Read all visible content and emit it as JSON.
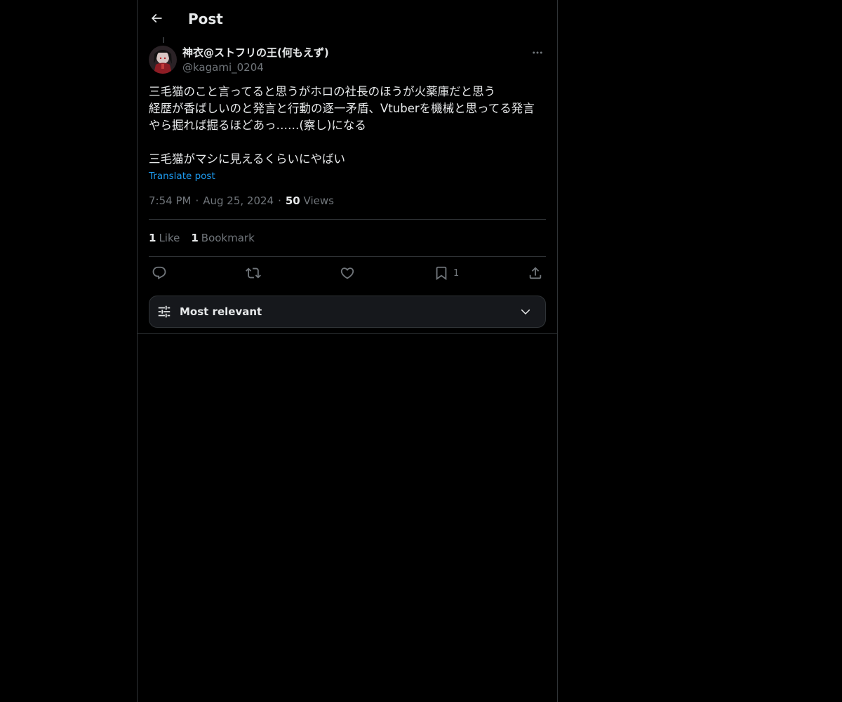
{
  "header": {
    "title": "Post",
    "back_icon": "arrow-left-icon"
  },
  "post": {
    "author": {
      "display_name": "神衣@ストフリの王(何もえず)",
      "handle": "@kagami_0204",
      "avatar_icon": "avatar-image"
    },
    "text": "三毛猫のこと言ってると思うがホロの社長のほうが火薬庫だと思う\n経歴が香ばしいのと発言と行動の逐一矛盾、Vtuberを機械と思ってる発言やら掘れば掘るほどあっ……(察し)になる\n\n三毛猫がマシに見えるくらいにやばい",
    "translate_label": "Translate post",
    "time": "7:54 PM",
    "date": "Aug 25, 2024",
    "views_count": "50",
    "views_label": "Views",
    "separator": "·"
  },
  "stats": {
    "likes_count": "1",
    "likes_label": "Like",
    "bookmarks_count": "1",
    "bookmarks_label": "Bookmark"
  },
  "actions": {
    "reply_icon": "reply-icon",
    "repost_icon": "repost-icon",
    "like_icon": "heart-icon",
    "bookmark_icon": "bookmark-icon",
    "bookmark_count": "1",
    "share_icon": "share-icon"
  },
  "sort": {
    "label": "Most relevant",
    "icon": "sliders-icon",
    "chevron": "chevron-down-icon"
  },
  "colors": {
    "background": "#000000",
    "border": "#2f3336",
    "text": "#e7e9ea",
    "muted": "#71767b",
    "accent": "#1d9bf0",
    "sort_bg": "#16181c"
  }
}
